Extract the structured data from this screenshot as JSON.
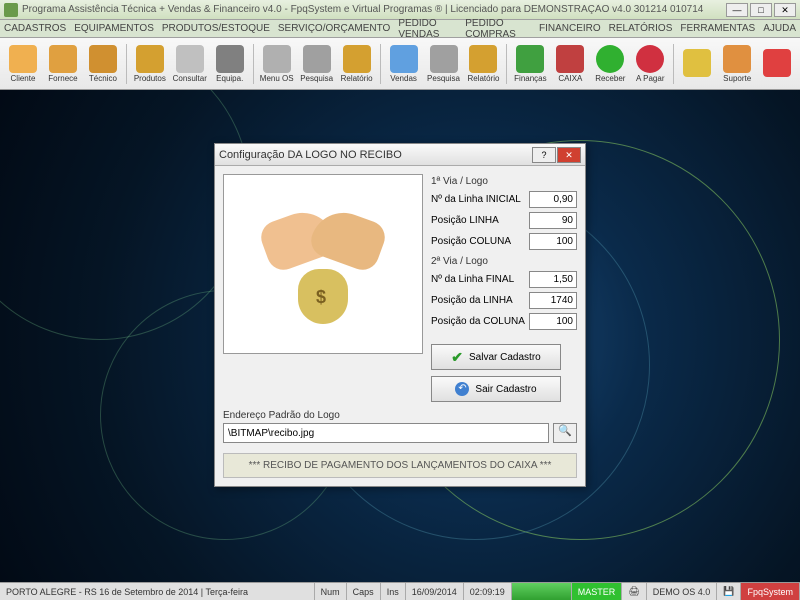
{
  "titlebar": {
    "text": "Programa Assistência Técnica + Vendas & Financeiro v4.0 - FpqSystem e Virtual Programas ® | Licenciado para  DEMONSTRAÇÃO v4.0 301214 010714"
  },
  "menu": {
    "items": [
      "CADASTROS",
      "EQUIPAMENTOS",
      "PRODUTOS/ESTOQUE",
      "SERVIÇO/ORÇAMENTO",
      "PEDIDO VENDAS",
      "PEDIDO COMPRAS",
      "FINANCEIRO",
      "RELATÓRIOS",
      "FERRAMENTAS",
      "AJUDA"
    ]
  },
  "toolbar": {
    "items": [
      {
        "label": "Cliente",
        "icon": "ic-person1"
      },
      {
        "label": "Fornece",
        "icon": "ic-person2"
      },
      {
        "label": "Técnico",
        "icon": "ic-person3"
      },
      {
        "sep": true
      },
      {
        "label": "Produtos",
        "icon": "ic-box"
      },
      {
        "label": "Consultar",
        "icon": "ic-search"
      },
      {
        "label": "Equipa.",
        "icon": "ic-equip"
      },
      {
        "sep": true
      },
      {
        "label": "Menu OS",
        "icon": "ic-menu"
      },
      {
        "label": "Pesquisa",
        "icon": "ic-zoom"
      },
      {
        "label": "Relatório",
        "icon": "ic-report"
      },
      {
        "sep": true
      },
      {
        "label": "Vendas",
        "icon": "ic-monitor"
      },
      {
        "label": "Pesquisa",
        "icon": "ic-zoom"
      },
      {
        "label": "Relatório",
        "icon": "ic-report"
      },
      {
        "sep": true
      },
      {
        "label": "Finanças",
        "icon": "ic-fin"
      },
      {
        "label": "CAIXA",
        "icon": "ic-caixa"
      },
      {
        "label": "Receber",
        "icon": "ic-receber"
      },
      {
        "label": "A Pagar",
        "icon": "ic-pagar"
      },
      {
        "sep": true
      },
      {
        "label": "",
        "icon": "ic-bell"
      },
      {
        "label": "Suporte",
        "icon": "ic-sup"
      },
      {
        "label": "",
        "icon": "ic-exit"
      }
    ]
  },
  "dialog": {
    "title": "Configuração DA LOGO NO RECIBO",
    "section1": "1ª Via / Logo",
    "f1_label": "Nº da Linha INICIAL",
    "f1_val": "0,90",
    "f2_label": "Posição LINHA",
    "f2_val": "90",
    "f3_label": "Posição COLUNA",
    "f3_val": "100",
    "section2": "2ª Via / Logo",
    "f4_label": "Nº da Linha FINAL",
    "f4_val": "1,50",
    "f5_label": "Posição da LINHA",
    "f5_val": "1740",
    "f6_label": "Posição da COLUNA",
    "f6_val": "100",
    "path_label": "Endereço Padrão do Logo",
    "path_value": "\\BITMAP\\recibo.jpg",
    "btn_save": "Salvar Cadastro",
    "btn_exit": "Sair Cadastro",
    "footer": "*** RECIBO DE PAGAMENTO DOS LANÇAMENTOS DO CAIXA ***"
  },
  "status": {
    "location": "PORTO ALEGRE - RS 16 de Setembro de 2014 | Terça-feira",
    "num": "Num",
    "caps": "Caps",
    "ins": "Ins",
    "date": "16/09/2014",
    "time": "02:09:19",
    "master": "MASTER",
    "demo": "DEMO OS 4.0",
    "fpq": "FpqSystem"
  }
}
